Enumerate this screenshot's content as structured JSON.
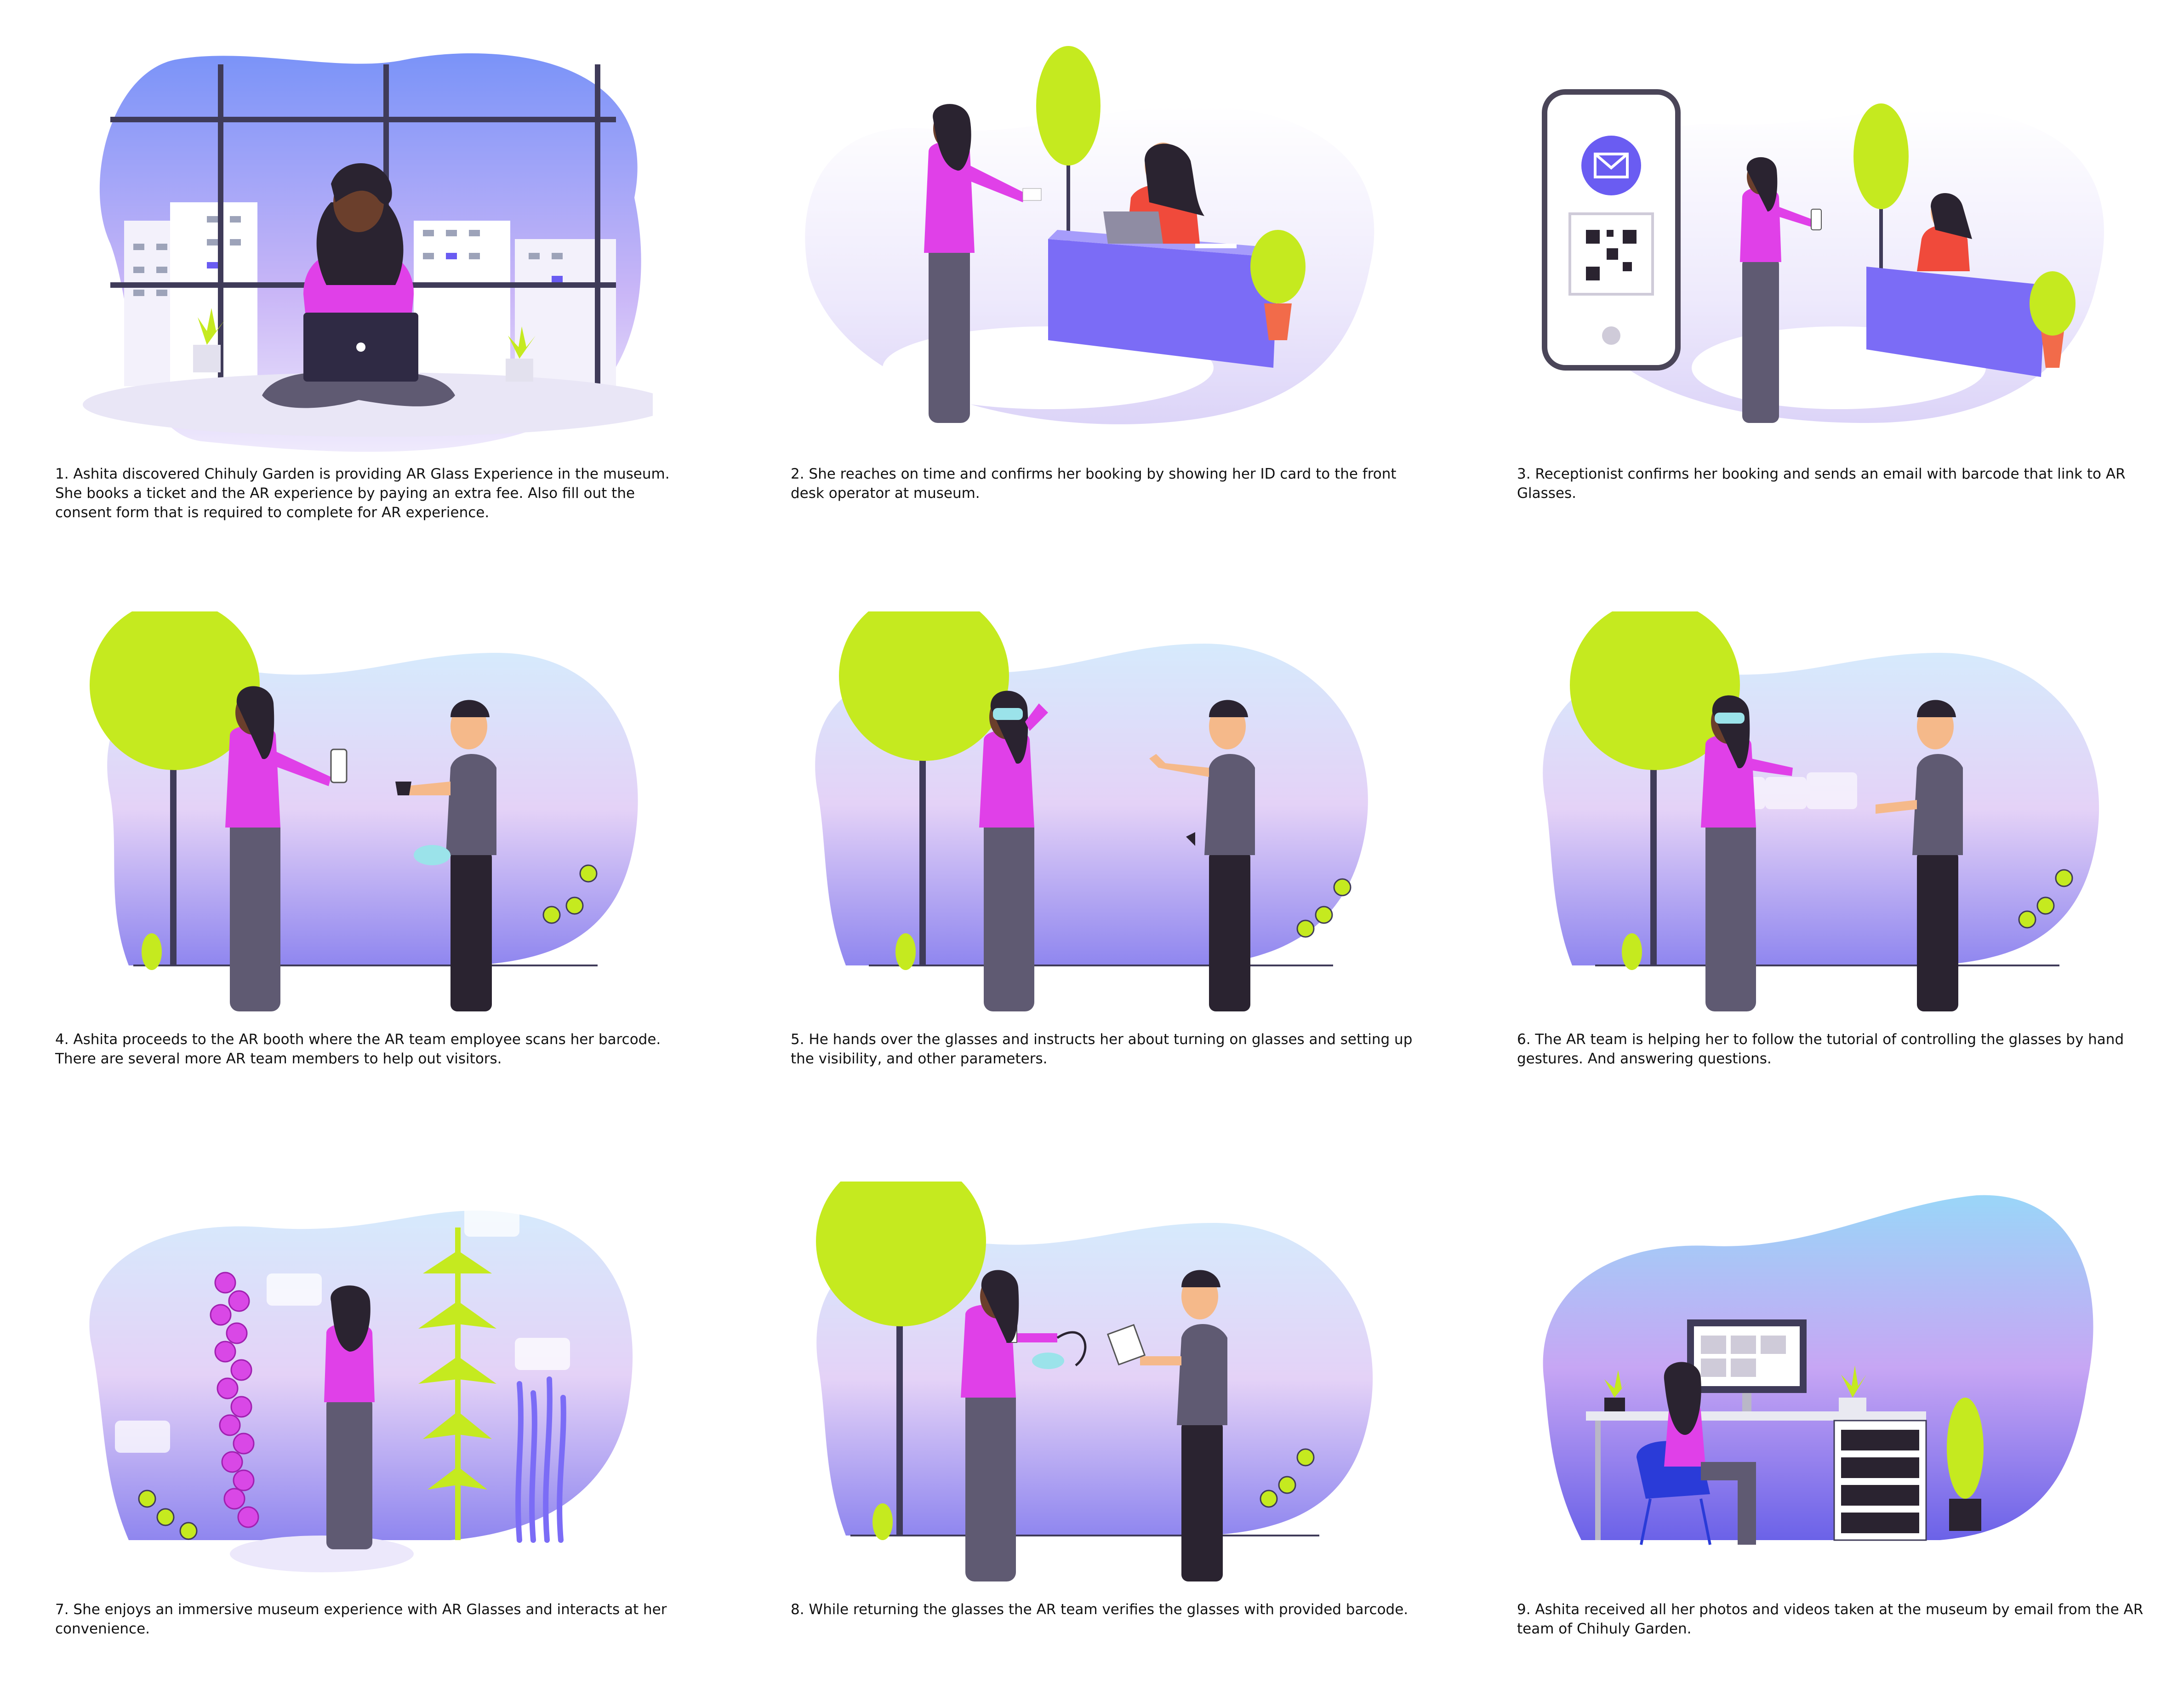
{
  "panels": [
    {
      "caption": "1. Ashita discovered Chihuly Garden is providing AR Glass Experience in the museum.\nShe books a ticket and the AR experience by paying an extra fee. Also fill out the\nconsent form that is required to complete for AR experience."
    },
    {
      "caption": "2. She reaches on time and confirms her booking by showing her ID card to the front\ndesk operator at museum."
    },
    {
      "caption": "3. Receptionist confirms her booking and sends an email with barcode that link to AR\nGlasses."
    },
    {
      "caption": "4. Ashita proceeds to the AR booth where the AR team employee scans her barcode.\nThere are several more AR team members to help out visitors."
    },
    {
      "caption": "5. He hands over the glasses and instructs her about turning on glasses and setting up\nthe visibility, and other parameters."
    },
    {
      "caption": "6. The AR team is helping her to follow the tutorial of controlling the glasses by hand\ngestures. And answering questions."
    },
    {
      "caption": "7. She enjoys an immersive museum experience with AR Glasses and interacts at her\n convenience."
    },
    {
      "caption": "8. While returning the glasses the AR team verifies the glasses with provided barcode."
    },
    {
      "caption": "9. Ashita received all her photos and videos taken at the museum by email from the AR\nteam of Chihuly Garden."
    }
  ],
  "colors": {
    "tree": "#c5ea1f",
    "accent_purple": "#7b6cf6",
    "shirt_pink": "#e040e8",
    "pants_gray": "#5f5a72",
    "skin_dark": "#6b3f2c",
    "skin_light": "#f5b98a",
    "receptionist_red": "#f04a3b",
    "pot_orange": "#f26b4a"
  },
  "icons": [
    "mail-icon",
    "qr-code-icon",
    "laptop-icon",
    "ar-glasses-icon"
  ]
}
